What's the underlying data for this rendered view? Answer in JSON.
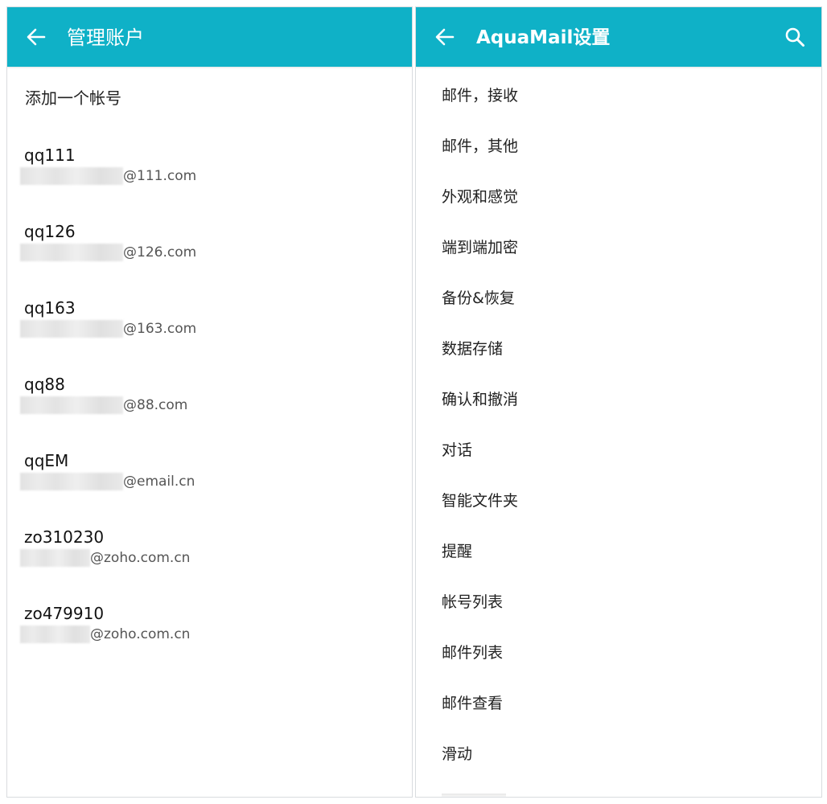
{
  "left": {
    "title": "管理账户",
    "add_account_label": "添加一个帐号",
    "accounts": [
      {
        "name": "qq111",
        "domain": "@111.com"
      },
      {
        "name": "qq126",
        "domain": "@126.com"
      },
      {
        "name": "qq163",
        "domain": "@163.com"
      },
      {
        "name": "qq88",
        "domain": "@88.com"
      },
      {
        "name": "qqEM",
        "domain": "@email.cn"
      },
      {
        "name": "zo310230",
        "domain": "@zoho.com.cn"
      },
      {
        "name": "zo479910",
        "domain": "@zoho.com.cn"
      }
    ]
  },
  "right": {
    "title": "AquaMail设置",
    "items": [
      "邮件，接收",
      "邮件，其他",
      "外观和感觉",
      "端到端加密",
      "备份&恢复",
      "数据存储",
      "确认和撤消",
      "对话",
      "智能文件夹",
      "提醒",
      "帐号列表",
      "邮件列表",
      "邮件查看",
      "滑动"
    ]
  },
  "icons": {
    "back": "arrow-left-icon",
    "search": "search-icon"
  },
  "colors": {
    "appbar": "#0fb1c7",
    "text": "#222222",
    "secondary_text": "#555555"
  }
}
